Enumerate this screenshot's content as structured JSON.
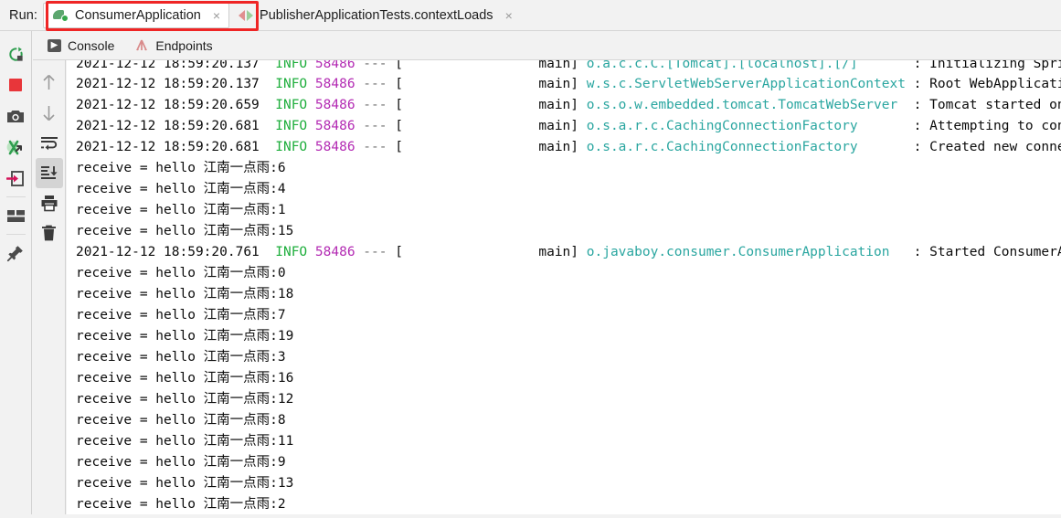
{
  "window": {
    "run_label": "Run:",
    "tabs": [
      {
        "label": "ConsumerApplication",
        "icon": "run-coverage-icon",
        "close": "×",
        "active": true,
        "highlighted": true
      },
      {
        "label": "PublisherApplicationTests.contextLoads",
        "icon": "test-run-icon",
        "close": "×",
        "active": false,
        "highlighted": false
      }
    ]
  },
  "console_tabs": [
    {
      "label": "Console",
      "icon": "console-icon",
      "selected": true
    },
    {
      "label": "Endpoints",
      "icon": "endpoints-icon",
      "selected": false
    }
  ],
  "run_toolbar": [
    {
      "name": "rerun-icon",
      "title": "Rerun"
    },
    {
      "name": "stop-icon",
      "title": "Stop"
    },
    {
      "name": "camera-icon",
      "title": "Screenshot"
    },
    {
      "name": "threads-icon",
      "title": "Threads"
    },
    {
      "name": "exit-icon",
      "title": "Exit"
    },
    {
      "name": "layout-icon",
      "title": "Layout"
    },
    {
      "name": "pin-icon",
      "title": "Pin Tab"
    }
  ],
  "console_toolbar": [
    {
      "name": "arrow-up-icon",
      "title": "Up the stack trace"
    },
    {
      "name": "arrow-down-icon",
      "title": "Down the stack trace"
    },
    {
      "name": "soft-wrap-icon",
      "title": "Soft-Wrap"
    },
    {
      "name": "scroll-to-end-icon",
      "title": "Scroll to the end",
      "pressed": true
    },
    {
      "name": "print-icon",
      "title": "Print"
    },
    {
      "name": "trash-icon",
      "title": "Clear All"
    }
  ],
  "colors": {
    "highlight_box": "#ef2525",
    "info_level": "#1eae3c",
    "pid": "#b32ab3",
    "logger_class": "#2aa6a0",
    "message": "#0b0b0b",
    "console_bg": "#ffffff",
    "chrome_bg": "#f2f2f2"
  },
  "console_lines": [
    {
      "clipped": true,
      "kind": "log",
      "ts": "2021-12-12 18:59:20.137",
      "level": "INFO",
      "pid": "58486",
      "sep": "---",
      "bracket": "[",
      "thread": "main]",
      "logger": "o.a.c.c.C.[Tomcat].[localhost].[/]",
      "colon": ":",
      "message": "Initializing Spring"
    },
    {
      "clipped": false,
      "kind": "log",
      "ts": "2021-12-12 18:59:20.137",
      "level": "INFO",
      "pid": "58486",
      "sep": "---",
      "bracket": "[",
      "thread": "main]",
      "logger": "w.s.c.ServletWebServerApplicationContext",
      "colon": ":",
      "message": "Root WebApplication"
    },
    {
      "clipped": false,
      "kind": "log",
      "ts": "2021-12-12 18:59:20.659",
      "level": "INFO",
      "pid": "58486",
      "sep": "---",
      "bracket": "[",
      "thread": "main]",
      "logger": "o.s.o.w.embedded.tomcat.TomcatWebServer",
      "colon": ":",
      "message": "Tomcat started on p"
    },
    {
      "clipped": false,
      "kind": "log",
      "ts": "2021-12-12 18:59:20.681",
      "level": "INFO",
      "pid": "58486",
      "sep": "---",
      "bracket": "[",
      "thread": "main]",
      "logger": "o.s.a.r.c.CachingConnectionFactory",
      "colon": ":",
      "message": "Attempting to conne"
    },
    {
      "clipped": false,
      "kind": "log",
      "ts": "2021-12-12 18:59:20.681",
      "level": "INFO",
      "pid": "58486",
      "sep": "---",
      "bracket": "[",
      "thread": "main]",
      "logger": "o.s.a.r.c.CachingConnectionFactory",
      "colon": ":",
      "message": "Created new connect"
    },
    {
      "clipped": false,
      "kind": "plain",
      "text": "receive = hello 江南一点雨:6"
    },
    {
      "clipped": false,
      "kind": "plain",
      "text": "receive = hello 江南一点雨:4"
    },
    {
      "clipped": false,
      "kind": "plain",
      "text": "receive = hello 江南一点雨:1"
    },
    {
      "clipped": false,
      "kind": "plain",
      "text": "receive = hello 江南一点雨:15"
    },
    {
      "clipped": false,
      "kind": "log",
      "ts": "2021-12-12 18:59:20.761",
      "level": "INFO",
      "pid": "58486",
      "sep": "---",
      "bracket": "[",
      "thread": "main]",
      "logger": "o.javaboy.consumer.ConsumerApplication",
      "colon": ":",
      "message": "Started ConsumerApp"
    },
    {
      "clipped": false,
      "kind": "plain",
      "text": "receive = hello 江南一点雨:0"
    },
    {
      "clipped": false,
      "kind": "plain",
      "text": "receive = hello 江南一点雨:18"
    },
    {
      "clipped": false,
      "kind": "plain",
      "text": "receive = hello 江南一点雨:7"
    },
    {
      "clipped": false,
      "kind": "plain",
      "text": "receive = hello 江南一点雨:19"
    },
    {
      "clipped": false,
      "kind": "plain",
      "text": "receive = hello 江南一点雨:3"
    },
    {
      "clipped": false,
      "kind": "plain",
      "text": "receive = hello 江南一点雨:16"
    },
    {
      "clipped": false,
      "kind": "plain",
      "text": "receive = hello 江南一点雨:12"
    },
    {
      "clipped": false,
      "kind": "plain",
      "text": "receive = hello 江南一点雨:8"
    },
    {
      "clipped": false,
      "kind": "plain",
      "text": "receive = hello 江南一点雨:11"
    },
    {
      "clipped": false,
      "kind": "plain",
      "text": "receive = hello 江南一点雨:9"
    },
    {
      "clipped": false,
      "kind": "plain",
      "text": "receive = hello 江南一点雨:13"
    },
    {
      "clipped": false,
      "kind": "plain",
      "text": "receive = hello 江南一点雨:2"
    }
  ]
}
